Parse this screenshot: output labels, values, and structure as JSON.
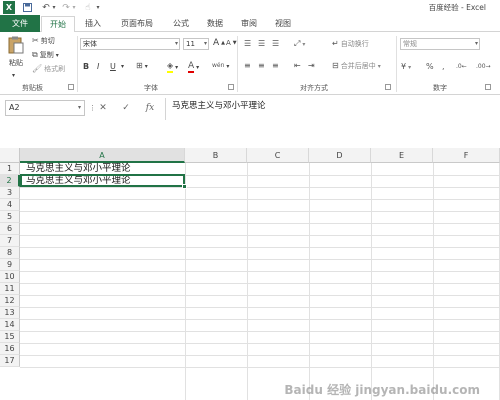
{
  "titlebar": {
    "app_icon": "excel-icon",
    "save_icon": "save-icon",
    "undo_icon": "undo-icon",
    "redo_icon": "redo-icon",
    "touch_icon": "touch-mode-icon",
    "title": "百度经验 - Excel",
    "brand_color": "#217346"
  },
  "tabs": [
    {
      "label": "文件"
    },
    {
      "label": "开始"
    },
    {
      "label": "插入"
    },
    {
      "label": "页面布局"
    },
    {
      "label": "公式"
    },
    {
      "label": "数据"
    },
    {
      "label": "审阅"
    },
    {
      "label": "视图"
    }
  ],
  "ribbon": {
    "clipboard": {
      "paste": "粘贴",
      "cut": "剪切",
      "copy": "复制",
      "format_painter": "格式刷",
      "group_name": "剪贴板"
    },
    "font": {
      "font_name": "宋体",
      "font_size": "11",
      "grow": "A",
      "shrink": "A",
      "bold": "B",
      "italic": "I",
      "underline": "U",
      "font_color_letter": "A",
      "phonetic": "wén",
      "group_name": "字体"
    },
    "alignment": {
      "wrap_text": "自动换行",
      "merge_center": "合并后居中",
      "group_name": "对齐方式"
    },
    "number": {
      "format": "常规",
      "percent": "%",
      "comma": ",",
      "group_name": "数字"
    }
  },
  "formula_bar": {
    "name_box": "A2",
    "cancel": "✕",
    "enter": "✓",
    "fx": "fx",
    "content": "马克思主义与邓小平理论"
  },
  "grid": {
    "columns": [
      "A",
      "B",
      "C",
      "D",
      "E",
      "F"
    ],
    "rows": [
      "1",
      "2",
      "3",
      "4",
      "5",
      "6",
      "7",
      "8",
      "9",
      "10",
      "11",
      "12",
      "13",
      "14",
      "15",
      "16",
      "17"
    ],
    "cells": {
      "A1": "马克思主义与邓小平理论",
      "A2": "马克思主义与邓小平理论"
    }
  },
  "watermark": "Baidu 经验 jingyan.baidu.com"
}
